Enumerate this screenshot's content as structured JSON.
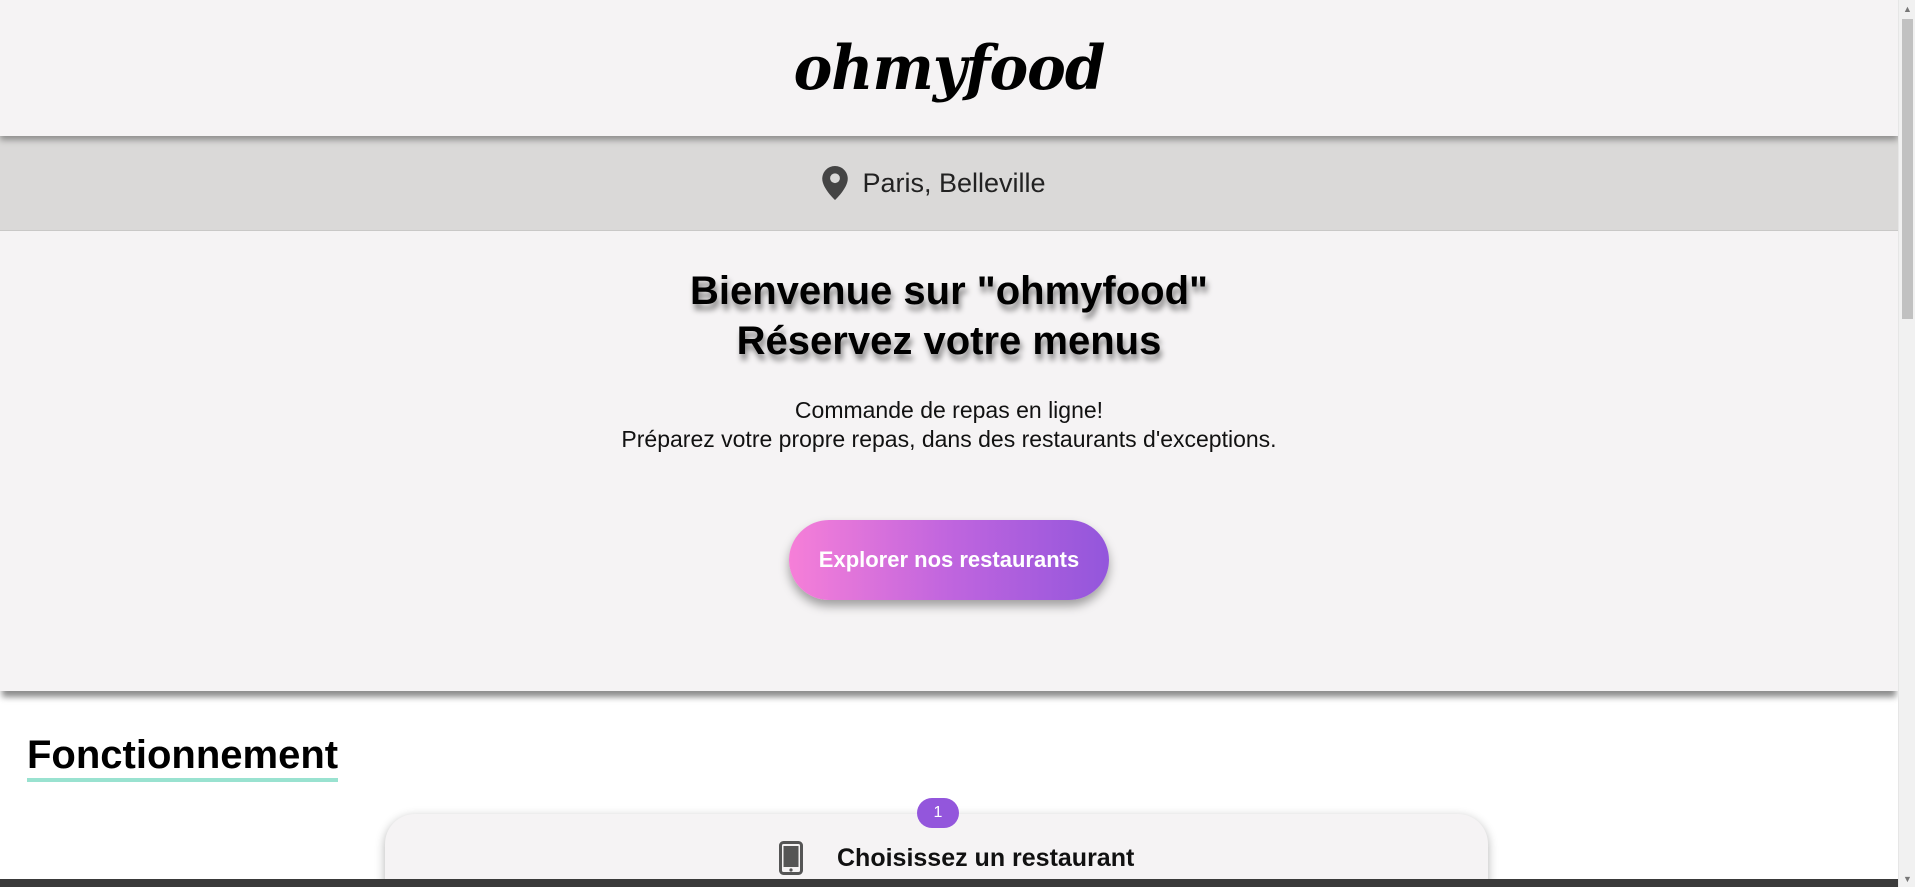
{
  "header": {
    "logo": "ohmyfood"
  },
  "location": {
    "icon": "map-pin-icon",
    "text": "Paris, Belleville"
  },
  "hero": {
    "title_line1": "Bienvenue sur \"ohmyfood\"",
    "title_line2": "Réservez votre menus",
    "subtitle_line1": "Commande de repas en ligne!",
    "subtitle_line2": "Préparez votre propre repas, dans des restaurants d'exceptions.",
    "cta_label": "Explorer nos restaurants"
  },
  "how_it_works": {
    "title": "Fonctionnement",
    "steps": [
      {
        "number": "1",
        "icon": "smartphone-icon",
        "label": "Choisissez un restaurant"
      }
    ]
  },
  "colors": {
    "header_bg": "#f5f3f4",
    "location_bg": "#dad9d8",
    "cta_gradient_start": "#f67fd8",
    "cta_gradient_end": "#9356dc",
    "title_underline": "#99e2d0",
    "badge": "#9356dc"
  }
}
